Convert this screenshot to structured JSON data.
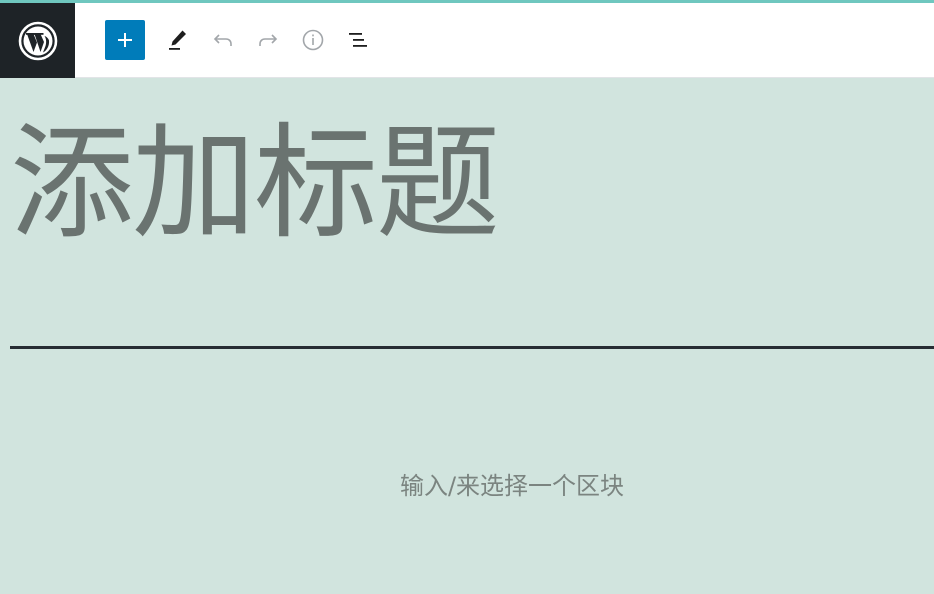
{
  "toolbar": {
    "logo_icon": "wordpress-logo-icon",
    "inserter_icon": "plus-icon",
    "tools_icon": "pencil-icon",
    "undo_icon": "undo-icon",
    "redo_icon": "redo-icon",
    "info_icon": "info-icon",
    "outline_icon": "list-view-icon"
  },
  "editor": {
    "title_placeholder": "添加标题",
    "block_placeholder": "输入/来选择一个区块"
  },
  "colors": {
    "accent_bar": "#6fc7bf",
    "logo_bg": "#1e2327",
    "inserter_bg": "#007cba",
    "canvas_bg": "#d1e4de"
  }
}
